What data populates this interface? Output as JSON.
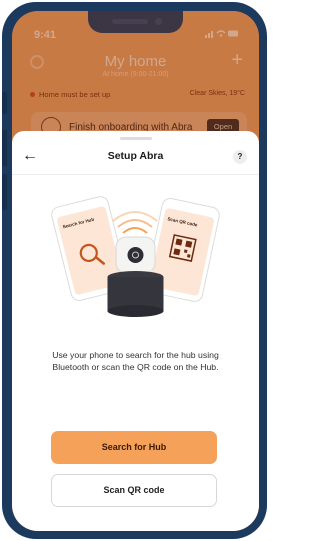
{
  "status": {
    "time": "9:41",
    "icons": "..ıl ≈ ▭"
  },
  "home": {
    "title": "My home",
    "subtitle": "At home (9:00-21:00)",
    "warning": "Home must be set up",
    "weather": "Clear Skies, 19°C",
    "onboarding_text": "Finish onboarding with Abra",
    "onboarding_button": "Open"
  },
  "sheet": {
    "title": "Setup Abra",
    "help_label": "?",
    "back_label": "←",
    "phone_left_label": "Search for Hub",
    "phone_right_label": "Scan QR code",
    "description": "Use your phone to search for the hub using Bluetooth or scan the QR code on the Hub.",
    "primary_button": "Search for Hub",
    "secondary_button": "Scan QR code"
  },
  "colors": {
    "frame": "#1c3a5e",
    "accent": "#f5a15a",
    "background": "#f3a15f"
  }
}
